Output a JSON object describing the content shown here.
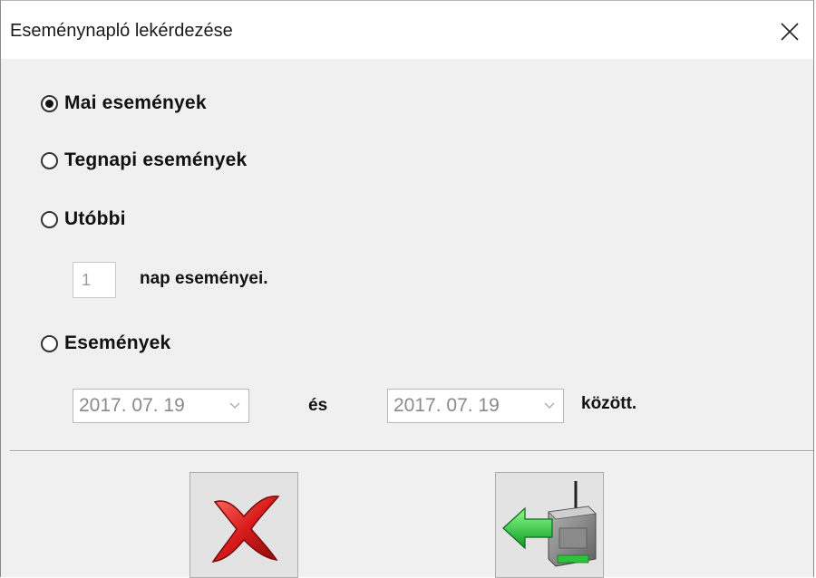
{
  "window": {
    "title": "Eseménynapló lekérdezése"
  },
  "options": [
    {
      "label": "Mai események",
      "checked": true
    },
    {
      "label": "Tegnapi események",
      "checked": false
    },
    {
      "label": "Utóbbi",
      "checked": false
    },
    {
      "label": "Események",
      "checked": false
    }
  ],
  "days": {
    "value": "1",
    "suffix": "nap eseményei."
  },
  "range": {
    "from": "2017. 07. 19",
    "conjunction": "és",
    "to": "2017. 07. 19",
    "suffix": "között."
  },
  "icons": {
    "close": "close-icon",
    "cancel": "red-x-icon",
    "download": "green-arrow-device-icon",
    "dropdown": "chevron-down-icon"
  },
  "colors": {
    "cancel_red": "#c8171b",
    "arrow_green": "#19b733",
    "device_gray": "#7d7d7d"
  }
}
